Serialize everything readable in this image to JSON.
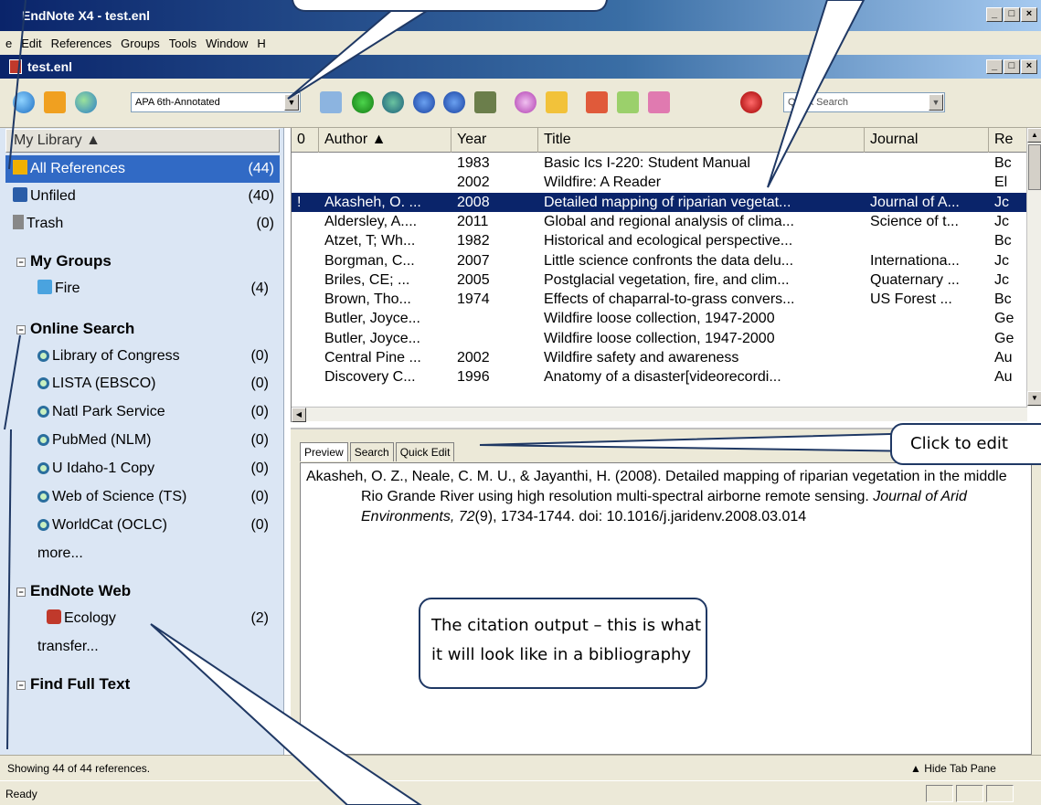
{
  "window": {
    "app_title": "EndNote X4 - test.enl",
    "doc_title": "test.enl",
    "min": "_",
    "max": "□",
    "close": "×"
  },
  "menu": [
    "e",
    "Edit",
    "References",
    "Groups",
    "Tools",
    "Window",
    "H"
  ],
  "toolbar": {
    "style": "APA 6th-Annotated",
    "search_placeholder": "Quick Search",
    "dropdown_arrow": "▼"
  },
  "library": {
    "header": "My Library ▲",
    "items": [
      {
        "label": "All References",
        "count": "(44)"
      },
      {
        "label": "Unfiled",
        "count": "(40)"
      },
      {
        "label": "Trash",
        "count": "(0)"
      }
    ],
    "my_groups": {
      "label": "My Groups",
      "items": [
        {
          "label": "Fire",
          "count": "(4)"
        }
      ]
    },
    "online_search": {
      "label": "Online Search",
      "items": [
        {
          "label": "Library of Congress",
          "count": "(0)"
        },
        {
          "label": "LISTA (EBSCO)",
          "count": "(0)"
        },
        {
          "label": "Natl Park Service",
          "count": "(0)"
        },
        {
          "label": "PubMed (NLM)",
          "count": "(0)"
        },
        {
          "label": "U Idaho-1 Copy",
          "count": "(0)"
        },
        {
          "label": "Web of Science (TS)",
          "count": "(0)"
        },
        {
          "label": "WorldCat (OCLC)",
          "count": "(0)"
        }
      ],
      "more": "more..."
    },
    "endnote_web": {
      "label": "EndNote Web",
      "items": [
        {
          "label": "Ecology",
          "count": "(2)"
        }
      ],
      "transfer": "transfer..."
    },
    "find_full_text": {
      "label": "Find Full Text"
    },
    "expander": "−"
  },
  "table": {
    "columns": [
      "0",
      "Author ▲",
      "Year",
      "Title",
      "Journal",
      "Re"
    ],
    "rows": [
      {
        "attach": "",
        "author": "",
        "year": "1983",
        "title": "Basic Ics I-220: Student Manual",
        "journal": "",
        "ref": "Bc"
      },
      {
        "attach": "",
        "author": "",
        "year": "2002",
        "title": "Wildfire: A Reader",
        "journal": "",
        "ref": "El"
      },
      {
        "attach": "!",
        "author": "Akasheh, O. ...",
        "year": "2008",
        "title": "Detailed mapping of riparian vegetat...",
        "journal": "Journal of A...",
        "ref": "Jc"
      },
      {
        "attach": "",
        "author": "Aldersley, A....",
        "year": "2011",
        "title": "Global and regional analysis of clima...",
        "journal": "Science of t...",
        "ref": "Jc"
      },
      {
        "attach": "",
        "author": "Atzet, T; Wh...",
        "year": "1982",
        "title": "Historical and ecological perspective...",
        "journal": "",
        "ref": "Bc"
      },
      {
        "attach": "",
        "author": "Borgman, C...",
        "year": "2007",
        "title": "Little science confronts the data delu...",
        "journal": "Internationa...",
        "ref": "Jc"
      },
      {
        "attach": "",
        "author": "Briles, CE; ...",
        "year": "2005",
        "title": "Postglacial vegetation, fire, and clim...",
        "journal": "Quaternary ...",
        "ref": "Jc"
      },
      {
        "attach": "",
        "author": "Brown, Tho...",
        "year": "1974",
        "title": "Effects of chaparral-to-grass convers...",
        "journal": "US Forest ...",
        "ref": "Bc"
      },
      {
        "attach": "",
        "author": "Butler, Joyce...",
        "year": "",
        "title": "Wildfire loose collection, 1947-2000",
        "journal": "",
        "ref": "Ge"
      },
      {
        "attach": "",
        "author": "Butler, Joyce...",
        "year": "",
        "title": "Wildfire loose collection, 1947-2000",
        "journal": "",
        "ref": "Ge"
      },
      {
        "attach": "",
        "author": "Central Pine ...",
        "year": "2002",
        "title": "Wildfire safety and awareness",
        "journal": "",
        "ref": "Au"
      },
      {
        "attach": "",
        "author": "Discovery C...",
        "year": "1996",
        "title": "Anatomy of a disaster[videorecordi...",
        "journal": "",
        "ref": "Au"
      }
    ],
    "scroll_up": "▲",
    "scroll_down": "▼",
    "scroll_left": "◀"
  },
  "preview": {
    "tabs": [
      "Preview",
      "Search",
      "Quick Edit"
    ],
    "citation_part1": "Akasheh, O. Z., Neale, C. M. U., & Jayanthi, H. (2008). Detailed mapping of riparian vegetation in the middle Rio Grande River using high resolution multi-spectral airborne remote sensing. ",
    "citation_journal": "Journal of Arid Environments, 72",
    "citation_part2": "(9), 1734-1744. doi: 10.1016/j.jaridenv.2008.03.014"
  },
  "status": {
    "showing": "Showing 44 of 44 references.",
    "hide_tab": "Hide Tab Pane",
    "ready": "Ready"
  },
  "callouts": {
    "edit": "Click to edit",
    "citation_line1": "The citation output – this is what",
    "citation_line2": "it will look like in a bibliography"
  }
}
